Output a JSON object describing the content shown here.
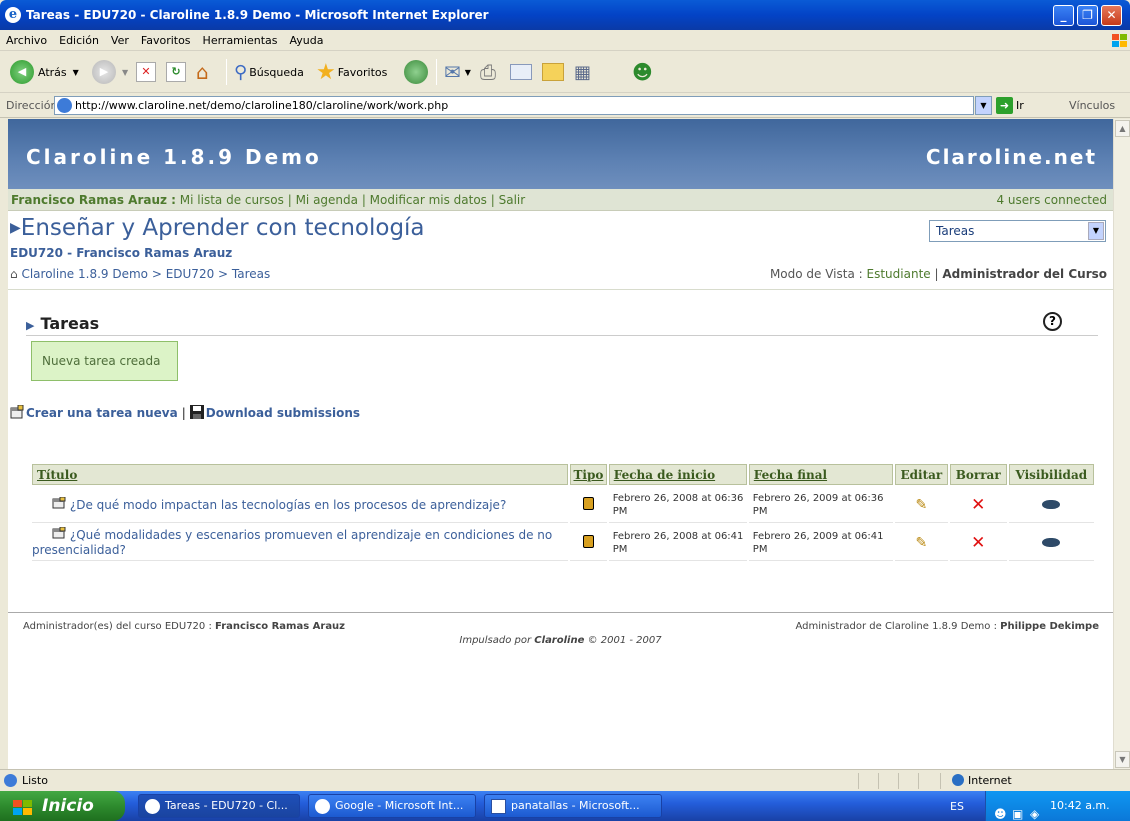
{
  "window": {
    "title": "Tareas - EDU720 - Claroline 1.8.9 Demo - Microsoft Internet Explorer"
  },
  "menu": [
    "Archivo",
    "Edición",
    "Ver",
    "Favoritos",
    "Herramientas",
    "Ayuda"
  ],
  "toolbar": {
    "back": "Atrás",
    "search": "Búsqueda",
    "favorites": "Favoritos"
  },
  "address": {
    "label": "Dirección",
    "url": "http://www.claroline.net/demo/claroline180/claroline/work/work.php",
    "go": "Ir",
    "links": "Vínculos"
  },
  "banner": {
    "left": "Claroline 1.8.9 Demo",
    "right": "Claroline.net"
  },
  "userbar": {
    "user": "Francisco Ramas Arauz :",
    "links": [
      "Mi lista de cursos",
      "Mi agenda",
      "Modificar mis datos",
      "Salir"
    ],
    "connected": "4 users connected"
  },
  "course": {
    "title": "Enseñar y Aprender con tecnología",
    "code": "EDU720 - Francisco Ramas Arauz"
  },
  "tool_select": {
    "value": "Tareas"
  },
  "breadcrumb": [
    "Claroline 1.8.9 Demo",
    "EDU720",
    "Tareas"
  ],
  "view_mode": {
    "label": "Modo de Vista :",
    "student": "Estudiante",
    "admin": "Administrador del Curso"
  },
  "tool": {
    "heading": "Tareas",
    "message": "Nueva tarea creada"
  },
  "actions": {
    "create": "Crear una tarea nueva",
    "download": "Download submissions"
  },
  "table": {
    "headers": [
      "Título",
      "Tipo",
      "Fecha de inicio",
      "Fecha final",
      "Editar",
      "Borrar",
      "Visibilidad"
    ],
    "rows": [
      {
        "title": "¿De qué modo impactan las tecnologías en los procesos de aprendizaje?",
        "start": "Febrero 26, 2008 at 06:36 PM",
        "end": "Febrero 26, 2009 at 06:36 PM"
      },
      {
        "title": "¿Qué modalidades y escenarios promueven el aprendizaje en condiciones de no presencialidad?",
        "start": "Febrero 26, 2008 at 06:41 PM",
        "end": "Febrero 26, 2009 at 06:41 PM"
      }
    ]
  },
  "footer": {
    "left_label": "Administrador(es) del curso EDU720 :",
    "left_name": "Francisco Ramas Arauz",
    "right_label": "Administrador de Claroline 1.8.9 Demo :",
    "right_name": "Philippe Dekimpe",
    "center_pre": "Impulsado por",
    "center_brand": "Claroline",
    "center_post": "© 2001 - 2007"
  },
  "status": {
    "text": "Listo",
    "zone": "Internet"
  },
  "taskbar": {
    "start": "Inicio",
    "tasks": [
      "Tareas - EDU720 - Cl...",
      "Google - Microsoft Int...",
      "panatallas - Microsoft..."
    ],
    "lang": "ES",
    "clock": "10:42 a.m."
  },
  "colors": {
    "banner": "#5d81b3",
    "link": "#3b5f9a",
    "green": "#4e7a2e",
    "delete": "#e01010"
  }
}
